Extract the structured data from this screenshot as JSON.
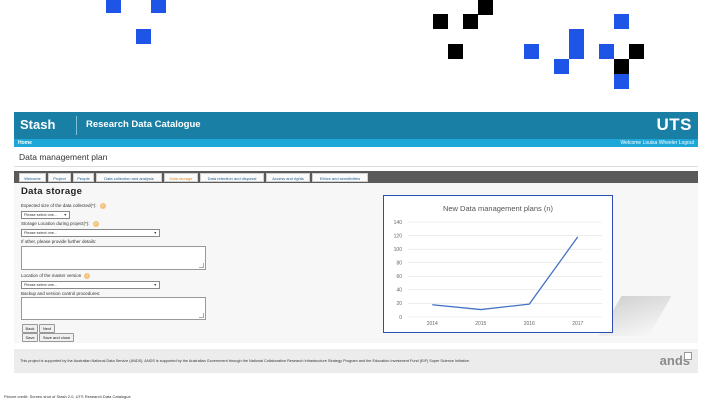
{
  "header": {
    "logo": "Stash",
    "title": "Research Data Catalogue",
    "brand": "UTS"
  },
  "subbar": {
    "home": "Home",
    "user": "Welcome Louisa Wheeler Logout"
  },
  "page_title": "Data management plan",
  "tabs": [
    {
      "label": "Welcome",
      "active": false
    },
    {
      "label": "Project",
      "active": false
    },
    {
      "label": "People",
      "active": false
    },
    {
      "label": "Data collection and analysis",
      "active": false
    },
    {
      "label": "Data storage",
      "active": true
    },
    {
      "label": "Data retention and disposal",
      "active": false
    },
    {
      "label": "Access and rights",
      "active": false
    },
    {
      "label": "Ethics and sensitivities",
      "active": false
    }
  ],
  "form": {
    "heading": "Data storage",
    "expected_size_label": "Expected size of the data collected(*):",
    "expected_size_value": "Please select one...",
    "storage_location_label": "Storage Location during project(*):",
    "storage_location_value": "Please select one...",
    "other_details_label": "If other, please provide further details:",
    "master_location_label": "Location of the master version",
    "master_location_value": "Please select one...",
    "backup_label": "Backup and version control procedures:",
    "help_mark": "?",
    "back_label": "Back",
    "next_label": "Next",
    "save_label": "Save",
    "save_close_label": "Save and close"
  },
  "footer": {
    "text": "This project is supported by the Australian National Data Service (ANDS). ANDS is supported by the Australian Government through the National Collaborative Research Infrastructure Strategy Program and the Education Investment Fund (EIF) Super Science Initiative.",
    "logo": "ands"
  },
  "credit": "Picture credit: Screen shot of Stash 2.0, UTS Research Data Catalogue",
  "colors": {
    "header": "#1a7fa5",
    "subbar": "#1da6d8",
    "accent_tab": "#e08b1c",
    "line": "#4472c4",
    "square_blue": "#1f55e6"
  },
  "chart_data": {
    "type": "line",
    "title": "New Data management plans (n)",
    "categories": [
      "2014",
      "2015",
      "2016",
      "2017"
    ],
    "series": [
      {
        "values": [
          18,
          11,
          19,
          118
        ]
      }
    ],
    "yticks": [
      0,
      20,
      40,
      60,
      80,
      100,
      120,
      140
    ],
    "ylim": [
      0,
      140
    ],
    "grid": true,
    "legend": "none"
  }
}
